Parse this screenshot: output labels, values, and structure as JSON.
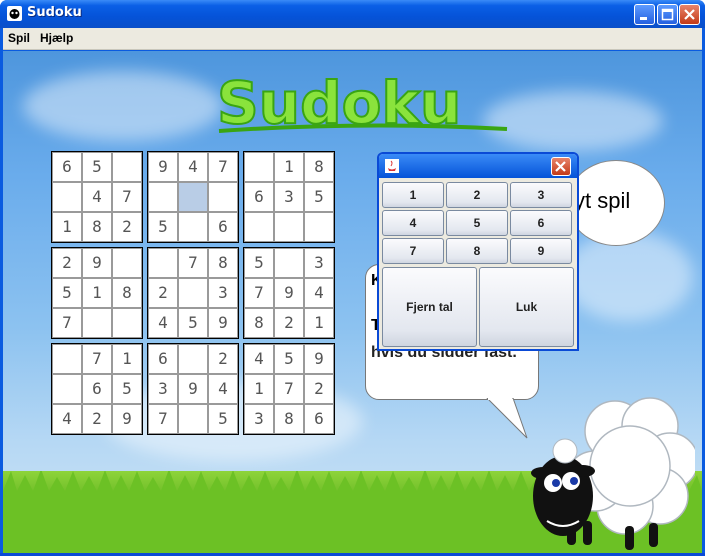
{
  "window": {
    "title": "Sudoku"
  },
  "menu": {
    "items": [
      "Spil",
      "Hjælp"
    ]
  },
  "logo": {
    "text": "Sudoku"
  },
  "sudoku": {
    "rows": [
      [
        "6",
        "5",
        "",
        "9",
        "4",
        "7",
        "",
        "1",
        "8"
      ],
      [
        "",
        "4",
        "7",
        "",
        "",
        "",
        "6",
        "3",
        "5"
      ],
      [
        "1",
        "8",
        "2",
        "5",
        "",
        "6",
        "",
        "",
        ""
      ],
      [
        "2",
        "9",
        "",
        "",
        "7",
        "8",
        "5",
        "",
        "3"
      ],
      [
        "5",
        "1",
        "8",
        "2",
        "",
        "3",
        "7",
        "9",
        "4"
      ],
      [
        "7",
        "",
        "",
        "4",
        "5",
        "9",
        "8",
        "2",
        "1"
      ],
      [
        "",
        "7",
        "1",
        "6",
        "",
        "2",
        "4",
        "5",
        "9"
      ],
      [
        "",
        "6",
        "5",
        "3",
        "9",
        "4",
        "1",
        "7",
        "2"
      ],
      [
        "4",
        "2",
        "9",
        "7",
        "",
        "5",
        "3",
        "8",
        "6"
      ]
    ],
    "selected": [
      1,
      4
    ]
  },
  "bubbles": {
    "new_game": "yt spil",
    "hint_k": "K",
    "hint_t": "T",
    "hint_text": "hvis du sidder fast."
  },
  "dialog": {
    "buttons": [
      "1",
      "2",
      "3",
      "4",
      "5",
      "6",
      "7",
      "8",
      "9"
    ],
    "remove_label": "Fjern tal",
    "close_label": "Luk"
  },
  "colors": {
    "title_bar": "#0553d8",
    "selected_cell": "#b9cde6"
  }
}
